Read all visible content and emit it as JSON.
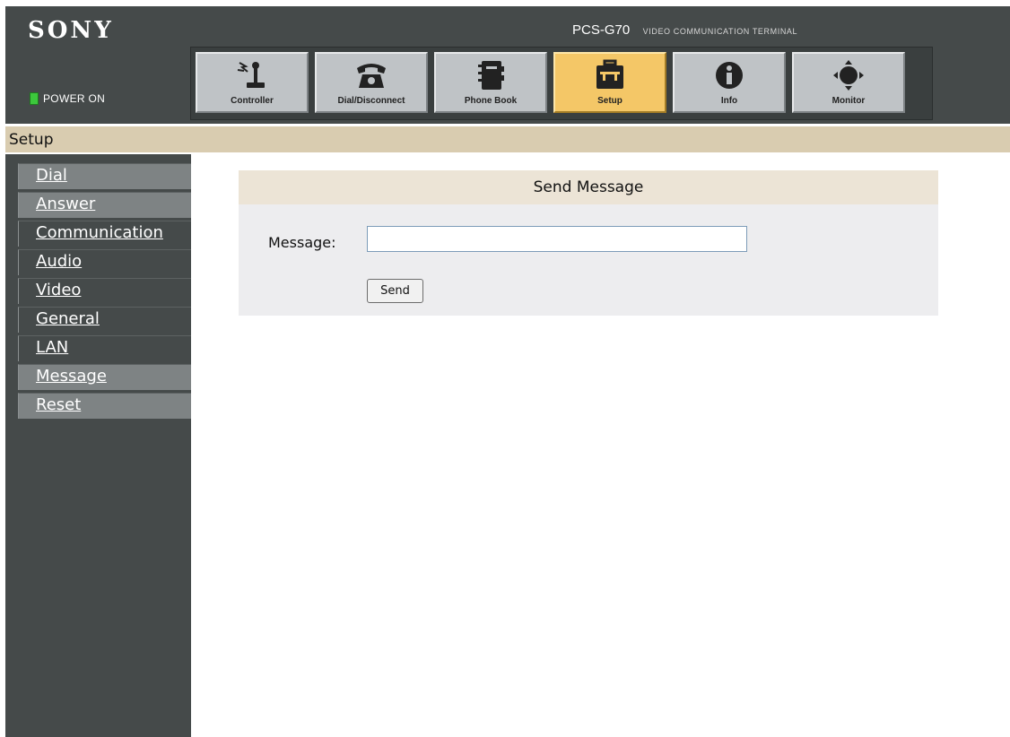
{
  "header": {
    "brand": "SONY",
    "power_label": "POWER ON",
    "model_name": "PCS-G70",
    "model_subtitle": "VIDEO COMMUNICATION TERMINAL"
  },
  "toolbar": {
    "items": [
      {
        "label": "Controller",
        "icon": "joystick-icon"
      },
      {
        "label": "Dial/Disconnect",
        "icon": "telephone-icon"
      },
      {
        "label": "Phone Book",
        "icon": "phone-book-icon"
      },
      {
        "label": "Setup",
        "icon": "toolbox-icon",
        "active": true
      },
      {
        "label": "Info",
        "icon": "info-icon"
      },
      {
        "label": "Monitor",
        "icon": "monitor-arrows-icon"
      }
    ]
  },
  "page_title": "Setup",
  "sidebar": {
    "items": [
      {
        "label": "Dial"
      },
      {
        "label": "Answer"
      },
      {
        "label": "Communication"
      },
      {
        "label": "Audio"
      },
      {
        "label": "Video"
      },
      {
        "label": "General"
      },
      {
        "label": "LAN"
      },
      {
        "label": "Message",
        "selected": true
      },
      {
        "label": "Reset"
      }
    ]
  },
  "panel": {
    "title": "Send Message",
    "message_label": "Message:",
    "message_value": "",
    "send_label": "Send"
  },
  "colors": {
    "header_bg": "#454a4a",
    "title_bar": "#d9ccb0",
    "active_tab": "#f4c767",
    "power_led": "#3cc83c"
  }
}
